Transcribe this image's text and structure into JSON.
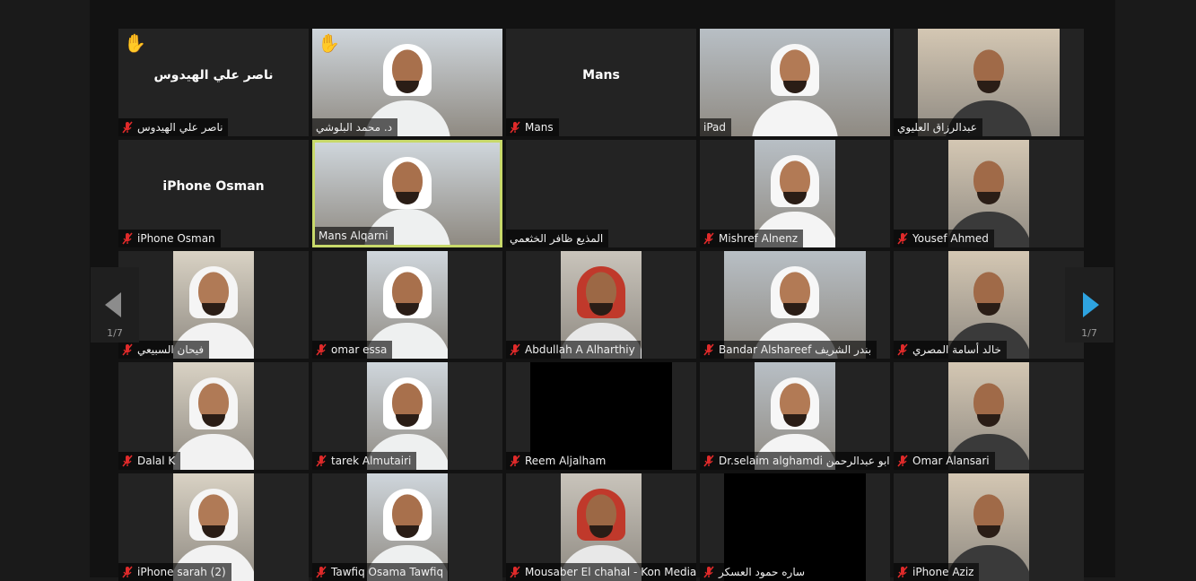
{
  "meeting": {
    "page_indicator": "1/7",
    "colors": {
      "active_speaker": "#c8d96a",
      "mute": "#e02a2a",
      "raise_hand": "#f2b52e",
      "tile_bg": "#232323"
    }
  },
  "tiles": [
    {
      "name": "ناصر علي الهيدوس",
      "display": "ناصر علي الهيدوس",
      "muted": true,
      "hand": true,
      "video": "none"
    },
    {
      "name": "د. محمد البلوشي",
      "muted": false,
      "hand": true,
      "video": "full"
    },
    {
      "name": "Mans",
      "display": "Mans",
      "muted": true,
      "video": "none"
    },
    {
      "name": "iPad",
      "muted": false,
      "video": "full"
    },
    {
      "name": "عبدالرزاق العليوي",
      "muted": false,
      "video": "wide"
    },
    {
      "name": "iPhone Osman",
      "display": "iPhone Osman",
      "muted": true,
      "video": "none"
    },
    {
      "name": "Mans Alqarni",
      "muted": false,
      "video": "full",
      "active": true
    },
    {
      "name": "المذيع ظافر الخثعمي",
      "muted": false,
      "video": "none"
    },
    {
      "name": "Mishref Alnenz",
      "muted": true,
      "video": "narrow"
    },
    {
      "name": "Yousef Ahmed",
      "muted": true,
      "video": "narrow"
    },
    {
      "name": "فيحان السبيعي",
      "muted": true,
      "video": "narrow"
    },
    {
      "name": "omar essa",
      "muted": true,
      "video": "narrow"
    },
    {
      "name": "Abdullah A Alharthiy",
      "muted": true,
      "video": "narrow"
    },
    {
      "name": "Bandar Alshareef بندر الشريف",
      "muted": true,
      "video": "wide"
    },
    {
      "name": "خالد أسامة المصري",
      "muted": true,
      "video": "narrow"
    },
    {
      "name": "Dalal K",
      "muted": true,
      "video": "narrow"
    },
    {
      "name": "tarek Almutairi",
      "muted": true,
      "video": "narrow"
    },
    {
      "name": "Reem Aljalham",
      "muted": true,
      "video": "black"
    },
    {
      "name": "Dr.selaim alghamdi ابو عبدالرحمن",
      "muted": true,
      "video": "narrow"
    },
    {
      "name": "Omar Alansari",
      "muted": true,
      "video": "narrow"
    },
    {
      "name": "iPhone sarah (2)",
      "muted": true,
      "video": "narrow"
    },
    {
      "name": "Tawfiq Osama Tawfiq",
      "muted": true,
      "video": "narrow"
    },
    {
      "name": "Mousaber El chahal - Kon Media",
      "muted": true,
      "video": "narrow"
    },
    {
      "name": "ساره حمود العسكر",
      "muted": true,
      "video": "black"
    },
    {
      "name": "iPhone Aziz",
      "muted": true,
      "video": "narrow"
    }
  ]
}
